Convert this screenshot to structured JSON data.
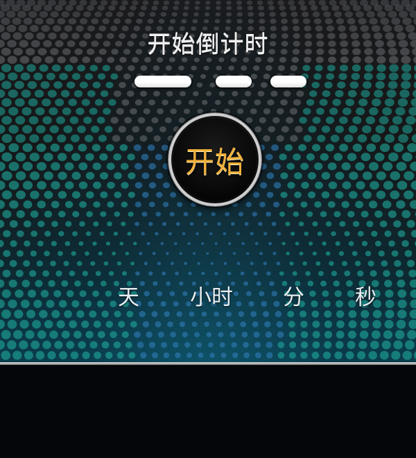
{
  "header": {
    "title": "开始倒计时"
  },
  "countdown": {
    "start_label": "开始",
    "units": {
      "day": "天",
      "hour": "小时",
      "minute": "分",
      "second": "秒"
    }
  },
  "theme": {
    "accent": "#f0b03a",
    "dot_teal": "#1fa79a",
    "dot_blue": "#2f7bb5",
    "dot_grey": "#6c6f73"
  }
}
